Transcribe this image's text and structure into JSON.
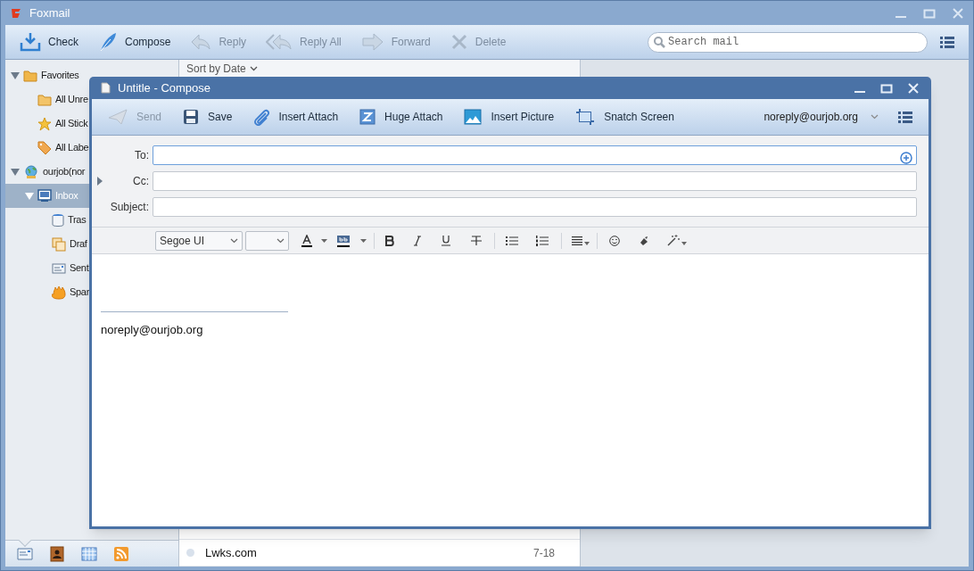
{
  "window": {
    "title": "Foxmail"
  },
  "toolbar": {
    "buttons": [
      {
        "label": "Check",
        "disabled": false
      },
      {
        "label": "Compose",
        "disabled": false
      },
      {
        "label": "Reply",
        "disabled": true
      },
      {
        "label": "Reply All",
        "disabled": true
      },
      {
        "label": "Forward",
        "disabled": true
      },
      {
        "label": "Delete",
        "disabled": true
      }
    ],
    "search": {
      "placeholder": "Search mail"
    }
  },
  "sidebar": {
    "items": [
      {
        "label": "Favorites",
        "expanded": true,
        "selected": false,
        "children": [
          {
            "label": "All Unre",
            "selected": false
          },
          {
            "label": "All Stick",
            "selected": false
          },
          {
            "label": "All Labe",
            "selected": false
          }
        ]
      },
      {
        "label": "ourjob(nor",
        "expanded": true,
        "selected": false,
        "children": [
          {
            "label": "Inbox",
            "expanded": true,
            "selected": true,
            "children": [
              {
                "label": "Tras",
                "selected": false
              },
              {
                "label": "Draf",
                "selected": false
              },
              {
                "label": "Sent",
                "selected": false
              },
              {
                "label": "Spar",
                "selected": false
              }
            ]
          }
        ]
      }
    ]
  },
  "bottom_nav": [
    {
      "selected": true
    },
    {
      "selected": false
    },
    {
      "selected": false
    },
    {
      "selected": false
    }
  ],
  "message_list": {
    "sort": "Sort by Date",
    "rows": [
      {
        "sender": "Lwks.com",
        "date": "7-18"
      }
    ]
  },
  "compose": {
    "title": "Untitle - Compose",
    "toolbar": [
      {
        "label": "Send",
        "disabled": true
      },
      {
        "label": "Save",
        "disabled": false
      },
      {
        "label": "Insert Attach",
        "disabled": false
      },
      {
        "label": "Huge Attach",
        "disabled": false
      },
      {
        "label": "Insert Picture",
        "disabled": false
      },
      {
        "label": "Snatch Screen",
        "disabled": false
      }
    ],
    "account": "noreply@ourjob.org",
    "fields": [
      {
        "label": "To:",
        "focused": true
      },
      {
        "label": "Cc:",
        "focused": false
      },
      {
        "label": "Subject:",
        "focused": false
      }
    ],
    "font": "Segoe UI",
    "signature": "noreply@ourjob.org"
  }
}
